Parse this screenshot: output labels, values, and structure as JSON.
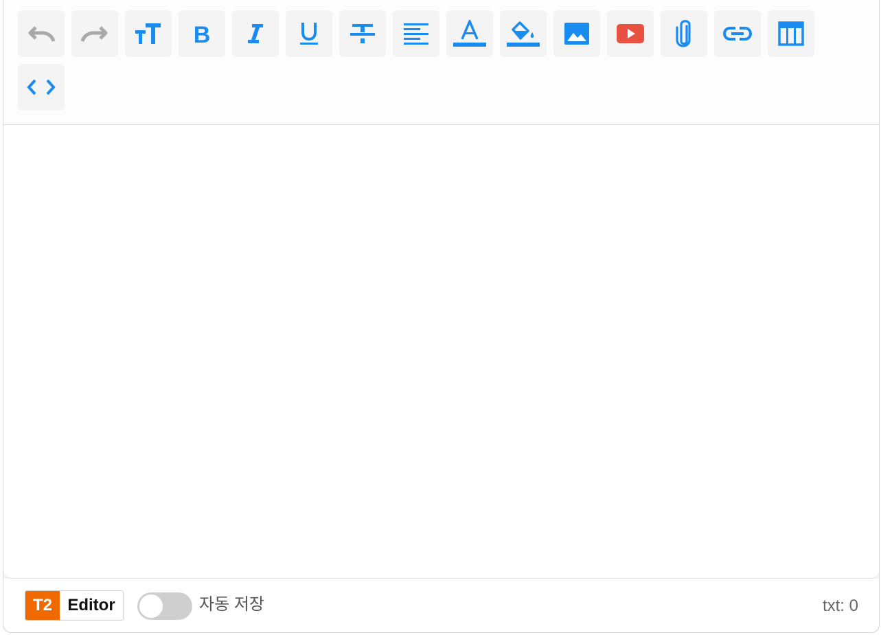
{
  "toolbar": {
    "buttons": [
      {
        "name": "undo-button",
        "icon": "undo-icon",
        "title": "Undo",
        "color": "#a9a9a9"
      },
      {
        "name": "redo-button",
        "icon": "redo-icon",
        "title": "Redo",
        "color": "#a9a9a9"
      },
      {
        "name": "font-size-button",
        "icon": "font-size-icon",
        "title": "Font size",
        "color": "#1a8cf0"
      },
      {
        "name": "bold-button",
        "icon": "bold-icon",
        "title": "Bold",
        "color": "#1a8cf0"
      },
      {
        "name": "italic-button",
        "icon": "italic-icon",
        "title": "Italic",
        "color": "#1a8cf0"
      },
      {
        "name": "underline-button",
        "icon": "underline-icon",
        "title": "Underline",
        "color": "#1a8cf0"
      },
      {
        "name": "strikethrough-button",
        "icon": "strikethrough-icon",
        "title": "Strikethrough",
        "color": "#1a8cf0"
      },
      {
        "name": "align-button",
        "icon": "align-left-icon",
        "title": "Align",
        "color": "#1a8cf0"
      },
      {
        "name": "text-color-button",
        "icon": "text-color-icon",
        "title": "Text color",
        "color": "#1a8cf0"
      },
      {
        "name": "background-color-button",
        "icon": "fill-color-icon",
        "title": "Background color",
        "color": "#1a8cf0"
      },
      {
        "name": "insert-image-button",
        "icon": "image-icon",
        "title": "Image",
        "color": "#1a8cf0"
      },
      {
        "name": "insert-video-button",
        "icon": "youtube-icon",
        "title": "Video",
        "color": "#e8503f"
      },
      {
        "name": "attach-file-button",
        "icon": "paperclip-icon",
        "title": "Attachment",
        "color": "#1a8cf0"
      },
      {
        "name": "insert-link-button",
        "icon": "link-icon",
        "title": "Link",
        "color": "#1a8cf0"
      },
      {
        "name": "insert-table-button",
        "icon": "table-icon",
        "title": "Table",
        "color": "#1a8cf0"
      },
      {
        "name": "code-view-button",
        "icon": "code-icon",
        "title": "Code",
        "color": "#1a8cf0"
      }
    ]
  },
  "footer": {
    "logo_mark": "T2",
    "logo_text": "Editor",
    "autosave_label": "자동 저장",
    "autosave_enabled": false,
    "txt_count": "txt: 0"
  },
  "colors": {
    "accent": "#1a8cf0",
    "disabled": "#a9a9a9",
    "video_red": "#e8503f",
    "logo_orange": "#f06a00"
  }
}
